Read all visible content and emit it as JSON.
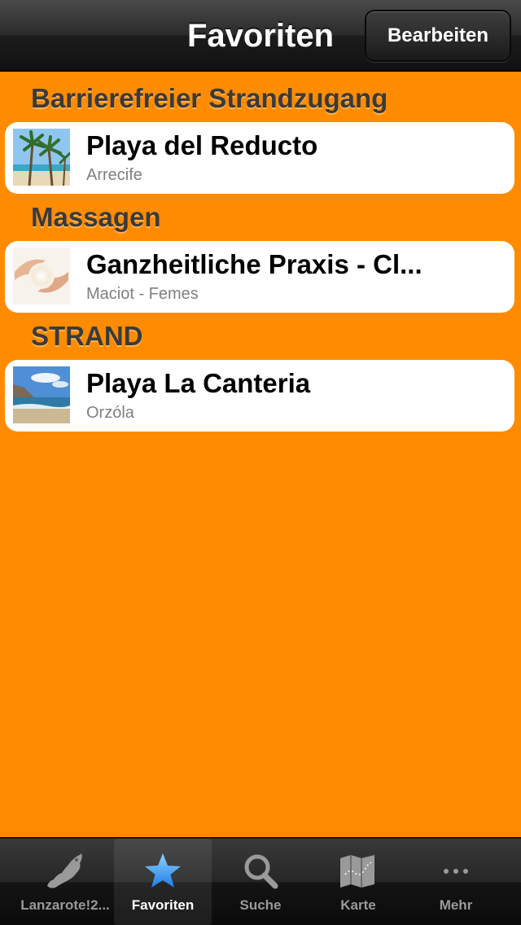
{
  "navbar": {
    "title": "Favoriten",
    "edit_button": "Bearbeiten"
  },
  "sections": [
    {
      "header": "Barrierefreier Strandzugang",
      "items": [
        {
          "title": "Playa del Reducto",
          "subtitle": "Arrecife",
          "thumbnail_icon": "palm-beach-thumbnail"
        }
      ]
    },
    {
      "header": "Massagen",
      "items": [
        {
          "title": "Ganzheitliche Praxis - Cl...",
          "subtitle": "Maciot - Femes",
          "thumbnail_icon": "massage-hands-thumbnail"
        }
      ]
    },
    {
      "header": "STRAND",
      "items": [
        {
          "title": "Playa La Canteria",
          "subtitle": "Orzóla",
          "thumbnail_icon": "coast-thumbnail"
        }
      ]
    }
  ],
  "tabbar": {
    "tabs": [
      {
        "label": "Lanzarote!2...",
        "icon": "island-icon",
        "selected": false
      },
      {
        "label": "Favoriten",
        "icon": "star-icon",
        "selected": true
      },
      {
        "label": "Suche",
        "icon": "search-icon",
        "selected": false
      },
      {
        "label": "Karte",
        "icon": "map-icon",
        "selected": false
      },
      {
        "label": "Mehr",
        "icon": "more-icon",
        "selected": false
      }
    ]
  },
  "colors": {
    "background": "#ff8c00",
    "section_header_text": "#3a3a3a",
    "selected_tab_icon": "#2a8df0"
  }
}
